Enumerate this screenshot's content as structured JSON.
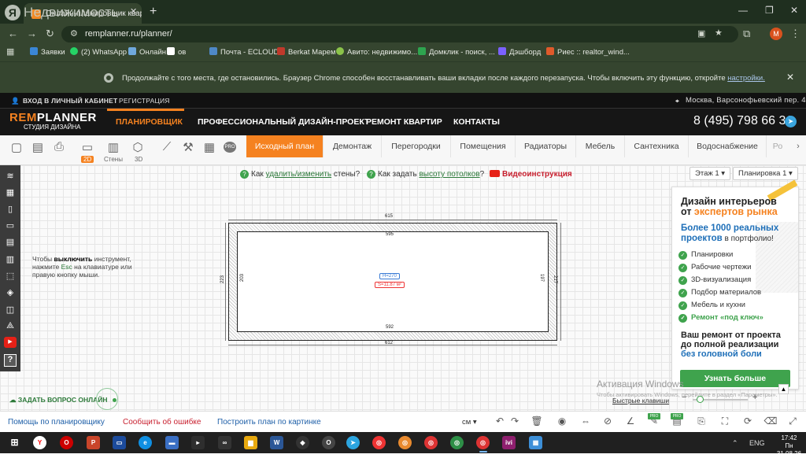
{
  "browser": {
    "overlay_brand": "Недвижимость",
    "tab_title": "Онлайн-планировщик кварт",
    "url": "remplanner.ru/planner/",
    "profile_initial": "M",
    "bookmarks": [
      "Заявки",
      "(2) WhatsApp",
      "Онлайн",
      "ов",
      "Почта - ECLOUD",
      "Berkat Марем",
      "Авито: недвижимо...",
      "Домклик - поиск, ...",
      "Дэшборд",
      "Риес :: realtor_wind..."
    ],
    "info_message": "Продолжайте с того места, где остановились. Браузер Chrome способен восстанавливать ваши вкладки после каждого перезапуска. Чтобы включить эту функцию, откройте",
    "info_link": "настройки."
  },
  "site": {
    "login": "ВХОД В ЛИЧНЫЙ КАБИНЕТ",
    "register": "РЕГИСТРАЦИЯ",
    "address": "Москва, Варсонофьевский пер. 4",
    "logo_rem": "REM",
    "logo_planner": "PLANNER",
    "logo_sub": "СТУДИЯ ДИЗАЙНА",
    "nav": [
      "ПЛАНИРОВЩИК",
      "ПРОФЕССИОНАЛЬНЫЙ ДИЗАЙН-ПРОЕКТ",
      "РЕМОНТ КВАРТИР",
      "КОНТАКТЫ"
    ],
    "phone": "8 (495) 798 66 31"
  },
  "planner": {
    "view_tags": [
      "2D",
      "Стены",
      "3D"
    ],
    "pro": "PRO",
    "tabs": [
      "Исходный план",
      "Демонтаж",
      "Перегородки",
      "Помещения",
      "Радиаторы",
      "Мебель",
      "Сантехника",
      "Водоснабжение",
      "Ро"
    ],
    "hint1_pre": "Как ",
    "hint1_link": "удалить/изменить",
    "hint1_post": " стены?",
    "hint2_pre": "Как задать ",
    "hint2_link": "высоту потолков",
    "hint2_post": "?",
    "video": "Видеоинструкция",
    "floor": "Этаж 1",
    "layout": "Планировка 1",
    "esc_1": "Чтобы ",
    "esc_bold": "выключить",
    "esc_2": " инструмент, нажмите ",
    "esc_key": "Esc",
    "esc_3": " на клавиатуре или правую кнопку мыши.",
    "room": {
      "top_outer": "615",
      "top_inner": "595",
      "bottom_inner": "592",
      "bottom_outer": "612",
      "left_outer": "223",
      "left_inner": "203",
      "right_inner": "197",
      "right_outer": "217",
      "height": "H=270",
      "area": "S=11.87 м²"
    },
    "ask_online": "ЗАДАТЬ ВОПРОС ОНЛАЙН",
    "hotkeys": "Быстрые клавиши",
    "win_activation": "Активация Windows",
    "win_activation_sub": "Чтобы активировать Windows, перейдите в раздел «Параметры»."
  },
  "ad": {
    "title_1": "Дизайн интерьеров",
    "title_2a": "от ",
    "title_2b": "экспертов рынка",
    "more_1": "Более 1000 реальных проектов",
    "more_2": " в портфолио!",
    "items": [
      "Планировки",
      "Рабочие чертежи",
      "3D-визуализация",
      "Подбор материалов",
      "Мебель и кухни",
      "Ремонт «под ключ»"
    ],
    "bottom_1": "Ваш ремонт от проекта",
    "bottom_2": "до полной реализации",
    "bottom_3": "без головной боли",
    "cta": "Узнать больше"
  },
  "bottom": {
    "help": "Помощь по планировщику",
    "report": "Сообщить об ошибке",
    "build": "Построить план по картинке",
    "unit": "см",
    "pro": "PRO"
  },
  "taskbar": {
    "lang": "ENG",
    "time": "17:42",
    "date": "Пн 31.08.26"
  },
  "colors": {
    "accent": "#f58220",
    "green": "#3fa34d",
    "link_red": "#c8202f",
    "link_blue": "#1e5fa8"
  }
}
